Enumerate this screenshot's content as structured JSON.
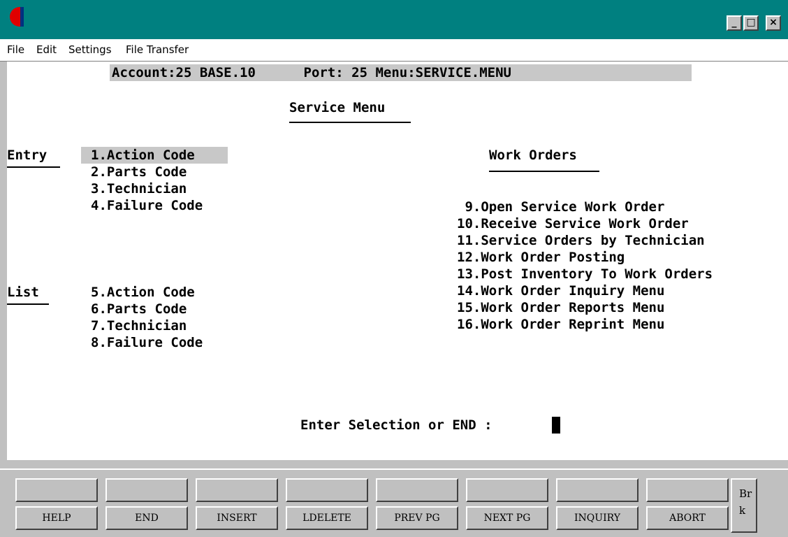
{
  "window": {
    "minimize": "_",
    "maximize": "□",
    "close": "×"
  },
  "menubar": [
    "File",
    "Edit",
    "Settings",
    "File Transfer"
  ],
  "status_line": "Account:25 BASE.10      Port: 25 Menu:SERVICE.MENU",
  "title": "Service Menu",
  "entry_section": {
    "label": "Entry",
    "items": [
      "1.Action Code",
      "2.Parts Code",
      "3.Technician",
      "4.Failure Code"
    ]
  },
  "list_section": {
    "label": "List",
    "items": [
      "5.Action Code",
      "6.Parts Code",
      "7.Technician",
      "8.Failure Code"
    ]
  },
  "work_orders": {
    "label": "Work Orders",
    "items": [
      " 9.Open Service Work Order",
      "10.Receive Service Work Order",
      "11.Service Orders by Technician",
      "12.Work Order Posting",
      "13.Post Inventory To Work Orders",
      "14.Work Order Inquiry Menu",
      "15.Work Order Reports Menu",
      "16.Work Order Reprint Menu"
    ]
  },
  "prompt": "Enter Selection or END :",
  "fkeys": {
    "top": [
      "",
      "",
      "",
      "",
      "",
      "",
      "",
      ""
    ],
    "bottom": [
      "HELP",
      "END",
      "INSERT",
      "LDELETE",
      "PREV PG",
      "NEXT PG",
      "INQUIRY",
      "ABORT"
    ]
  },
  "break_key": "Br\nk",
  "colors": {
    "titlebar": "#008080",
    "highlight": "#c8c8c8"
  }
}
